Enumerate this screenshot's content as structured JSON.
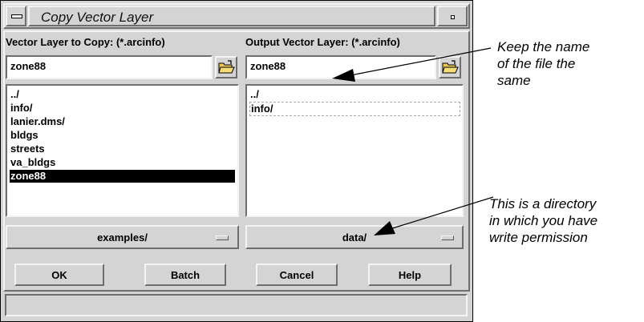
{
  "window": {
    "title": "Copy Vector Layer"
  },
  "left": {
    "label": "Vector Layer to Copy: (*.arcinfo)",
    "field_value": "zone88",
    "items": [
      "../",
      "info/",
      "lanier.dms/",
      "bldgs",
      "streets",
      "va_bldgs",
      "zone88"
    ],
    "selected_index": 6,
    "directory": "examples/"
  },
  "right": {
    "label": "Output Vector Layer: (*.arcinfo)",
    "field_value": "zone88",
    "items": [
      "../",
      "info/"
    ],
    "directory": "data/"
  },
  "buttons": {
    "ok": "OK",
    "batch": "Batch",
    "cancel": "Cancel",
    "help": "Help"
  },
  "status_text": "",
  "annotations": {
    "top": [
      "Keep the name",
      "of the file the",
      "same"
    ],
    "bottom": [
      "This is a directory",
      "in which you have",
      "write permission"
    ]
  },
  "icons": {
    "window_menu": "window-menu-icon",
    "minimize": "minimize-icon",
    "folder": "open-folder-icon",
    "dropdown": "option-menu-indicator-icon"
  },
  "colors": {
    "window_bg": "#d4d4d4",
    "field_bg": "#ffffff",
    "selection_bg": "#000000"
  }
}
